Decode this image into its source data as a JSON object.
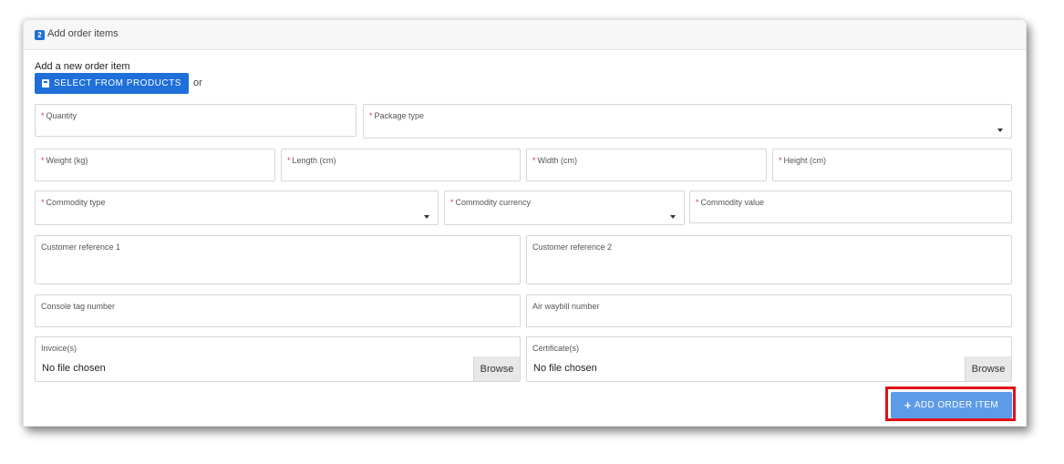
{
  "header": {
    "step": "2",
    "title": "Add order items"
  },
  "add_section": {
    "label": "Add a new order item",
    "select_button": "SELECT FROM PRODUCTS",
    "or": "or"
  },
  "required_mark": "*",
  "fields": {
    "quantity": "Quantity",
    "package_type": "Package type",
    "weight": "Weight (kg)",
    "length": "Length (cm)",
    "width": "Width (cm)",
    "height": "Height (cm)",
    "commodity_type": "Commodity type",
    "commodity_currency": "Commodity currency",
    "commodity_value": "Commodity value",
    "customer_ref_1": "Customer reference 1",
    "customer_ref_2": "Customer reference 2",
    "console_tag": "Console tag number",
    "air_waybill": "Air waybill number",
    "invoices": "Invoice(s)",
    "certificates": "Certificate(s)"
  },
  "file_inputs": {
    "no_file": "No file chosen",
    "browse": "Browse"
  },
  "actions": {
    "add_order_item": "ADD ORDER ITEM"
  },
  "colors": {
    "primary": "#1e6fd9",
    "add_button": "#5d9be8",
    "highlight": "#e0101a",
    "required": "#e53935"
  }
}
